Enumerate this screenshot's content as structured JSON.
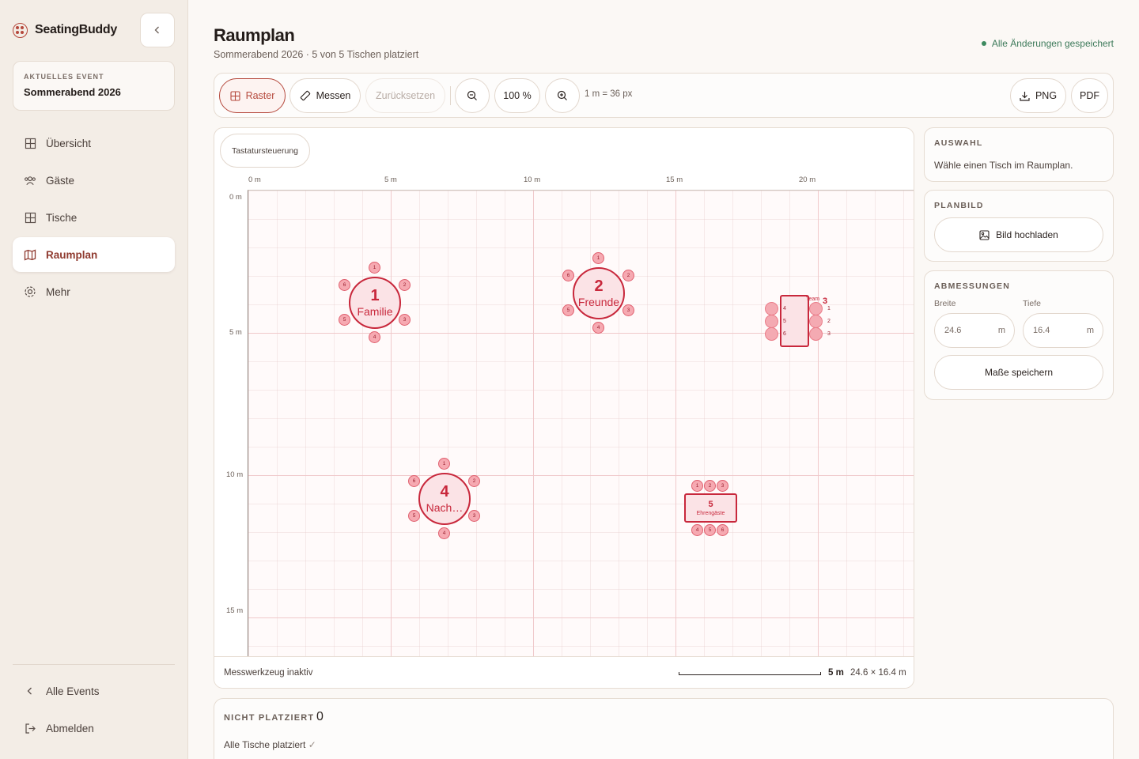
{
  "app": {
    "name": "SeatingBuddy"
  },
  "event_card": {
    "caption": "AKTUELLES EVENT",
    "name": "Sommerabend 2026"
  },
  "nav": {
    "items": [
      {
        "label": "Übersicht",
        "icon": "grid-icon"
      },
      {
        "label": "Gäste",
        "icon": "users-icon"
      },
      {
        "label": "Tische",
        "icon": "table-icon"
      },
      {
        "label": "Raumplan",
        "icon": "map-icon",
        "active": true
      },
      {
        "label": "Mehr",
        "icon": "gear-icon"
      }
    ],
    "bottom": [
      {
        "label": "Alle Events",
        "icon": "chevron-left-icon"
      },
      {
        "label": "Abmelden",
        "icon": "logout-icon"
      }
    ]
  },
  "header": {
    "title": "Raumplan",
    "subtitle": "Sommerabend 2026 · 5 von 5 Tischen platziert",
    "save_status": "Alle Änderungen gespeichert"
  },
  "toolbar": {
    "grid": "Raster",
    "measure": "Messen",
    "reset": "Zurücksetzen",
    "zoom": "100 %",
    "scale": "1 m = 36 px",
    "png": "PNG",
    "pdf": "PDF"
  },
  "canvas": {
    "keyboard": "Tastatursteuerung",
    "ruler_x": [
      "0 m",
      "5 m",
      "10 m",
      "15 m",
      "20 m"
    ],
    "ruler_y": [
      "0 m",
      "5 m",
      "10 m",
      "15 m"
    ],
    "measure_status": "Messwerkzeug inaktiv",
    "scale_label": "5 m",
    "dimensions": "24.6 × 16.4 m"
  },
  "tables": [
    {
      "number": "1",
      "name": "Familie",
      "seats": [
        "1",
        "2",
        "3",
        "4",
        "5",
        "6"
      ]
    },
    {
      "number": "2",
      "name": "Freunde",
      "seats": [
        "1",
        "2",
        "3",
        "4",
        "5",
        "6"
      ]
    },
    {
      "number": "3",
      "name": "Team",
      "seats": [
        "1",
        "2",
        "3",
        "4",
        "5",
        "6"
      ]
    },
    {
      "number": "4",
      "name": "Nach…",
      "seats": [
        "1",
        "2",
        "3",
        "4",
        "5",
        "6"
      ]
    },
    {
      "number": "5",
      "name": "Ehrengäste",
      "seats": [
        "1",
        "2",
        "3",
        "4",
        "5",
        "6"
      ]
    }
  ],
  "panels": {
    "selection": {
      "caption": "AUSWAHL",
      "text": "Wähle einen Tisch im Raumplan."
    },
    "image": {
      "caption": "PLANBILD",
      "button": "Bild hochladen"
    },
    "dimensions": {
      "caption": "ABMESSUNGEN",
      "width_label": "Breite",
      "width_value": "24.6",
      "width_unit": "m",
      "depth_label": "Tiefe",
      "depth_value": "16.4",
      "depth_unit": "m",
      "save": "Maße speichern"
    }
  },
  "unplaced": {
    "caption": "NICHT PLATZIERT",
    "count": "0",
    "text": "Alle Tische platziert",
    "check": "✓"
  }
}
